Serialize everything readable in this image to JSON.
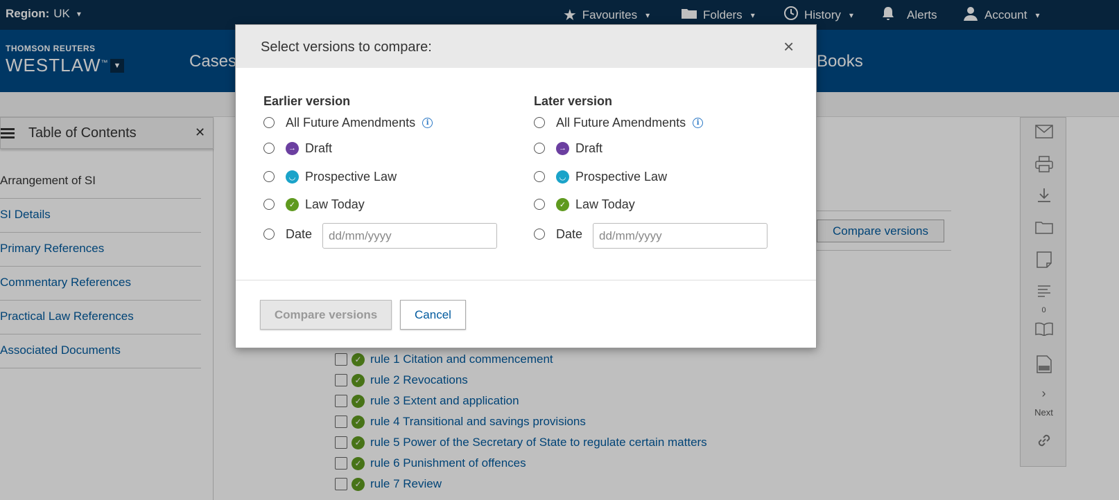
{
  "topbar": {
    "region_label": "Region:",
    "region_value": "UK",
    "favourites": "Favourites",
    "folders": "Folders",
    "history": "History",
    "alerts": "Alerts",
    "account": "Account"
  },
  "header": {
    "brand_top": "THOMSON REUTERS",
    "brand_main": "WESTLAW",
    "brand_tm": "™",
    "nav_cases": "Cases",
    "nav_books": "Books"
  },
  "toc": {
    "title": "Table of Contents",
    "items": [
      {
        "label": "Arrangement of SI"
      },
      {
        "label": "SI Details"
      },
      {
        "label": "Primary References"
      },
      {
        "label": "Commentary References"
      },
      {
        "label": "Practical Law References"
      },
      {
        "label": "Associated Documents"
      }
    ]
  },
  "main": {
    "compare_button": "Compare versions",
    "rules": [
      "rule 1 Citation and commencement",
      "rule 2 Revocations",
      "rule 3 Extent and application",
      "rule 4 Transitional and savings provisions",
      "rule 5 Power of the Secretary of State to regulate certain matters",
      "rule 6 Punishment of offences",
      "rule 7 Review"
    ]
  },
  "rail": {
    "next_label": "Next",
    "count": "0"
  },
  "modal": {
    "title": "Select versions to compare:",
    "close": "×",
    "earlier": {
      "heading": "Earlier version",
      "future": "All Future Amendments",
      "draft": "Draft",
      "prospective": "Prospective Law",
      "today": "Law Today",
      "date": "Date",
      "date_placeholder": "dd/mm/yyyy"
    },
    "later": {
      "heading": "Later version",
      "future": "All Future Amendments",
      "draft": "Draft",
      "prospective": "Prospective Law",
      "today": "Law Today",
      "date": "Date",
      "date_placeholder": "dd/mm/yyyy"
    },
    "compare_button": "Compare versions",
    "cancel_button": "Cancel"
  },
  "colors": {
    "topbar": "#0a2f4f",
    "header": "#004a86",
    "link": "#005a9e",
    "draft_badge": "#6b3fa0",
    "prospective_badge": "#1aa3c9",
    "today_badge": "#5f9a1f"
  }
}
